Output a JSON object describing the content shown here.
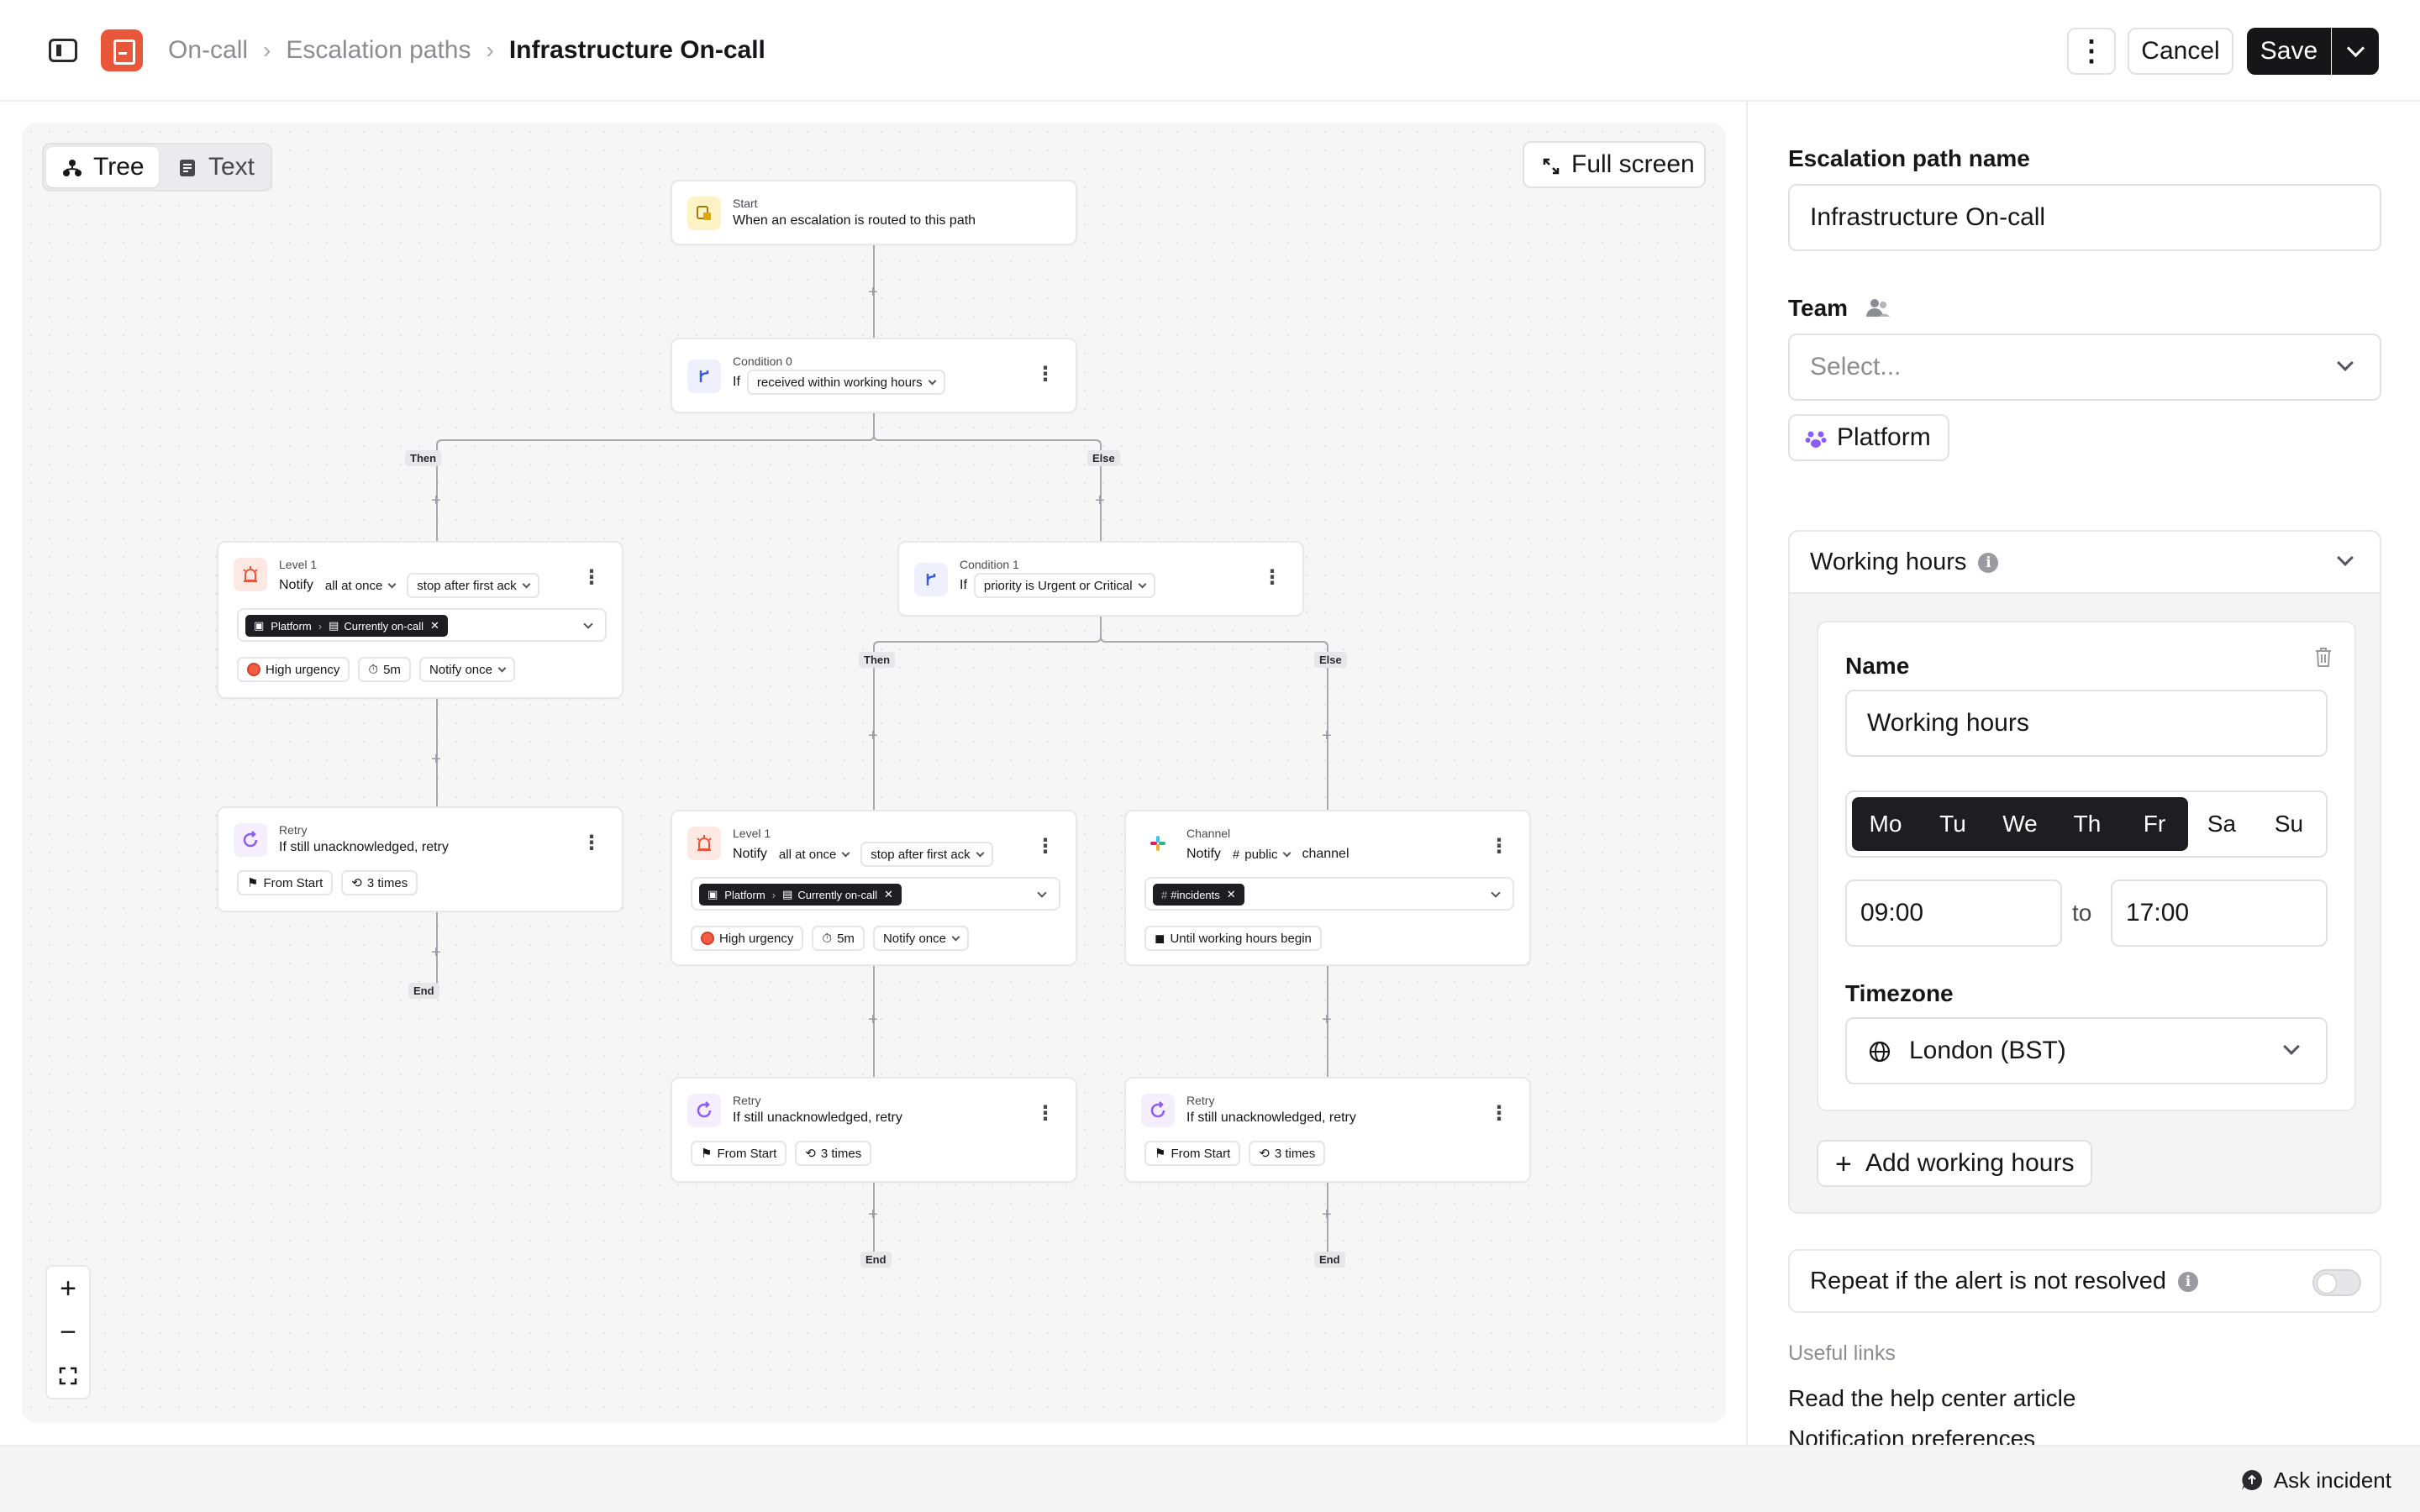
{
  "breadcrumb": {
    "root": "On-call",
    "section": "Escalation paths",
    "current": "Infrastructure On-call"
  },
  "header": {
    "cancel_label": "Cancel",
    "save_label": "Save"
  },
  "canvas": {
    "view_tree": "Tree",
    "view_text": "Text",
    "fullscreen_label": "Full screen",
    "branch_then": "Then",
    "branch_else": "Else",
    "end_label": "End"
  },
  "nodes": {
    "start": {
      "kicker": "Start",
      "title": "When an escalation is routed to this path"
    },
    "condition0": {
      "kicker": "Condition 0",
      "if_label": "If",
      "condition": "received within working hours"
    },
    "level1_a": {
      "kicker": "Level 1",
      "notify": "Notify",
      "mode": "all at once",
      "stop": "stop after first ack",
      "team": "Platform",
      "target": "Currently on-call",
      "urgency": "High urgency",
      "delay": "5m",
      "repeat": "Notify once"
    },
    "retry_a": {
      "kicker": "Retry",
      "title": "If still unacknowledged, retry",
      "from": "From Start",
      "times": "3 times"
    },
    "condition1": {
      "kicker": "Condition 1",
      "if_label": "If",
      "condition": "priority is Urgent or Critical"
    },
    "level1_b": {
      "kicker": "Level 1",
      "notify": "Notify",
      "mode": "all at once",
      "stop": "stop after first ack",
      "team": "Platform",
      "target": "Currently on-call",
      "urgency": "High urgency",
      "delay": "5m",
      "repeat": "Notify once"
    },
    "channel": {
      "kicker": "Channel",
      "notify": "Notify",
      "visibility": "public",
      "suffix": "channel",
      "channel_name": "#incidents",
      "wait": "Until working hours begin"
    },
    "retry_b": {
      "kicker": "Retry",
      "title": "If still unacknowledged, retry",
      "from": "From Start",
      "times": "3 times"
    },
    "retry_c": {
      "kicker": "Retry",
      "title": "If still unacknowledged, retry",
      "from": "From Start",
      "times": "3 times"
    }
  },
  "panel": {
    "name_label": "Escalation path name",
    "name_value": "Infrastructure On-call",
    "team_label": "Team",
    "team_placeholder": "Select...",
    "team_chip": "Platform",
    "working_hours_title": "Working hours",
    "wh_name_label": "Name",
    "wh_name_value": "Working hours",
    "days": [
      {
        "label": "Mo",
        "selected": true
      },
      {
        "label": "Tu",
        "selected": true
      },
      {
        "label": "We",
        "selected": true
      },
      {
        "label": "Th",
        "selected": true
      },
      {
        "label": "Fr",
        "selected": true
      },
      {
        "label": "Sa",
        "selected": false
      },
      {
        "label": "Su",
        "selected": false
      }
    ],
    "time_start": "09:00",
    "time_to": "to",
    "time_end": "17:00",
    "timezone_label": "Timezone",
    "timezone_value": "London (BST)",
    "add_working_hours": "Add working hours",
    "repeat_label": "Repeat if the alert is not resolved",
    "repeat_enabled": false,
    "useful_links_label": "Useful links",
    "link_help": "Read the help center article",
    "link_notifications": "Notification preferences"
  },
  "footer": {
    "ask_label": "Ask incident"
  },
  "colors": {
    "brand": "#e8573a",
    "primary": "#161618",
    "canvas_bg": "#f6f6f7",
    "team_purple": "#8b5cf6",
    "urgency_red": "#f25d45",
    "condition_blue": "#3b5bdb"
  }
}
